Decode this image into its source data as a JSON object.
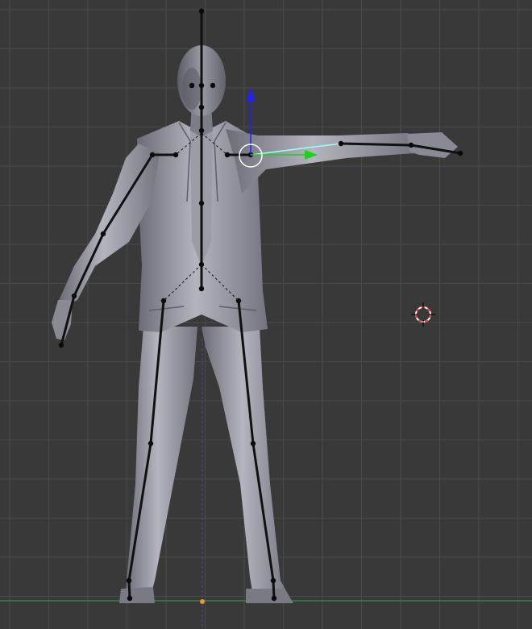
{
  "viewport": {
    "background_color": "#393939",
    "grid_color": "#4a4a4a",
    "floor_line_color": "#3fa048",
    "vertical_axis_color": "#4a4aa8",
    "origin_color": "#e8943a"
  },
  "model": {
    "body_color": "#8e8e98",
    "body_shade_color": "#6c6c78",
    "highlight_color": "#b4b4be"
  },
  "armature": {
    "bone_color": "#111111",
    "selected_bone_color": "#9ffcff",
    "joint_color": "#0a0a0a"
  },
  "manipulator": {
    "z_axis_color": "#1f1fff",
    "y_axis_color": "#1fcf1f",
    "ring_color": "#ffffff"
  },
  "cursor_3d": {
    "ring_color_a": "#ff3030",
    "ring_color_b": "#ffffff",
    "crosshair_color": "#000000"
  }
}
